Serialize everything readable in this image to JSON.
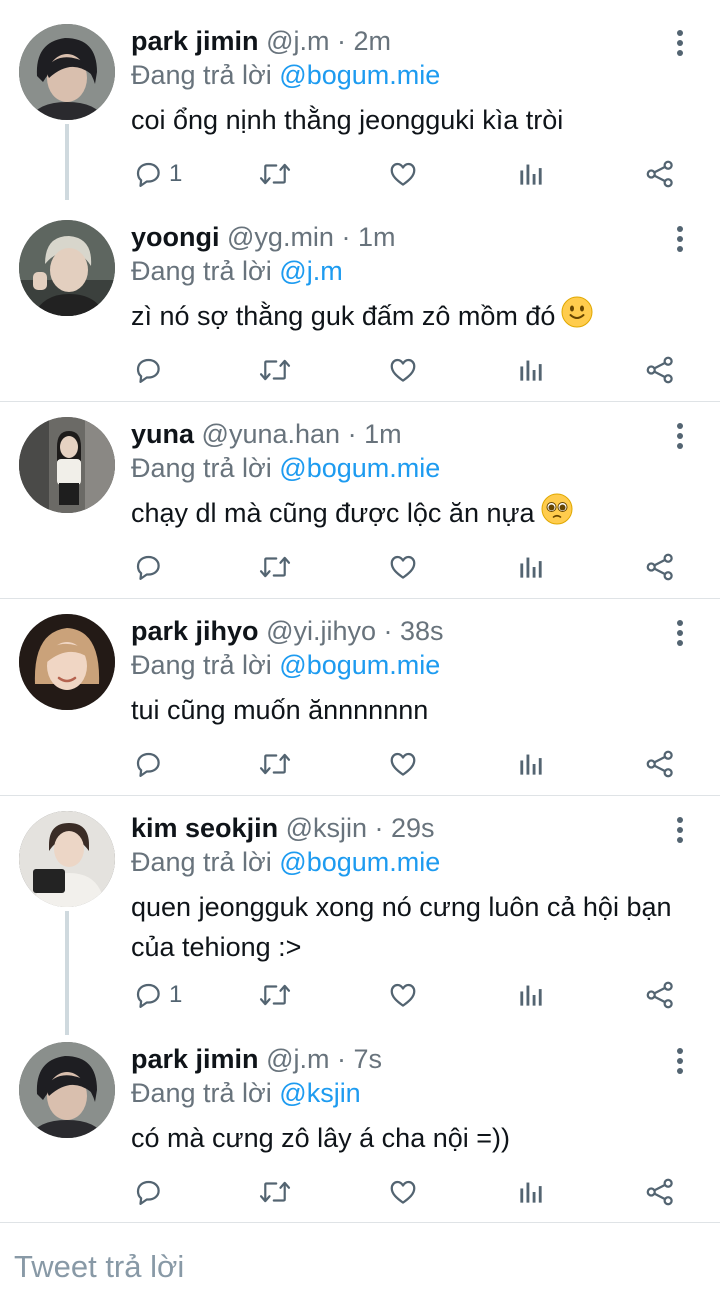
{
  "replying_prefix": "Đang trả lời",
  "tweets": [
    {
      "name": "park jimin",
      "handle": "@j.m",
      "time": "2m",
      "replying_to": "@bogum.mie",
      "text": "coi ổng nịnh thằng jeongguki kìa tròi",
      "reply_count": "1",
      "emoji": ""
    },
    {
      "name": "yoongi",
      "handle": "@yg.min",
      "time": "1m",
      "replying_to": "@j.m",
      "text": "zì nó sợ thằng guk đấm zô mồm đó",
      "reply_count": "",
      "emoji": "slightly-smiling-face"
    },
    {
      "name": "yuna",
      "handle": "@yuna.han",
      "time": "1m",
      "replying_to": "@bogum.mie",
      "text": "chạy dl mà cũng được lộc ăn nựa",
      "reply_count": "",
      "emoji": "pleading-face"
    },
    {
      "name": "park jihyo",
      "handle": "@yi.jihyo",
      "time": "38s",
      "replying_to": "@bogum.mie",
      "text": "tui cũng muốn ănnnnnnn",
      "reply_count": "",
      "emoji": ""
    },
    {
      "name": "kim seokjin",
      "handle": "@ksjin",
      "time": "29s",
      "replying_to": "@bogum.mie",
      "text": "quen jeongguk xong nó cưng luôn cả hội bạn của tehiong :>",
      "reply_count": "1",
      "emoji": ""
    },
    {
      "name": "park jimin",
      "handle": "@j.m",
      "time": "7s",
      "replying_to": "@ksjin",
      "text": "có mà cưng zô lây á cha nội =))",
      "reply_count": "",
      "emoji": ""
    }
  ],
  "reply_bar": {
    "placeholder": "Tweet trả lời"
  },
  "colors": {
    "mention": "#1d9bf0",
    "meta": "#68737c",
    "icon": "#536471",
    "thread_line": "#cfd9de",
    "divider": "#dfe3e6"
  },
  "icons": [
    "reply-icon",
    "retweet-icon",
    "like-icon",
    "analytics-icon",
    "share-icon",
    "more-vertical-icon"
  ]
}
